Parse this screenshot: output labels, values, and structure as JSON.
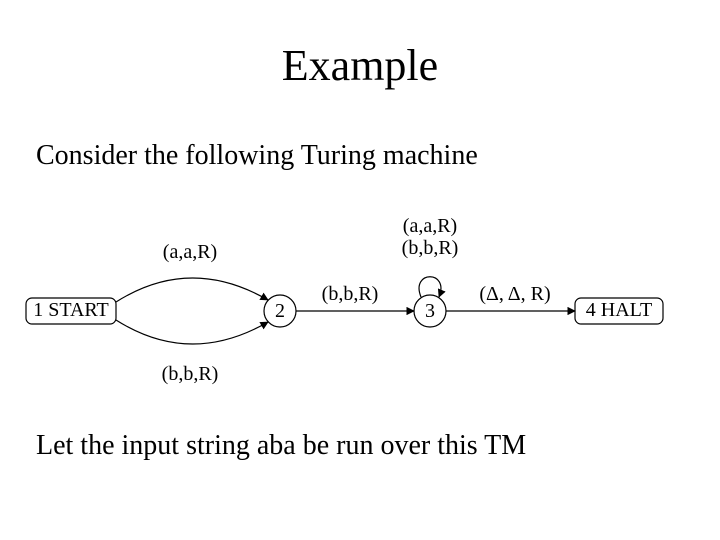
{
  "title": "Example",
  "subtitle": "Consider the following Turing machine",
  "footer": "Let the input string aba be run over this TM",
  "states": {
    "s1": "1 START",
    "s2": "2",
    "s3": "3",
    "s4": "4 HALT"
  },
  "transitions": {
    "t12_top": "(a,a,R)",
    "t12_bottom": "(b,b,R)",
    "t23": "(b,b,R)",
    "t33_top": "(a,a,R)",
    "t33_bottom": "(b,b,R)",
    "t34": "(Δ, Δ, R)"
  }
}
